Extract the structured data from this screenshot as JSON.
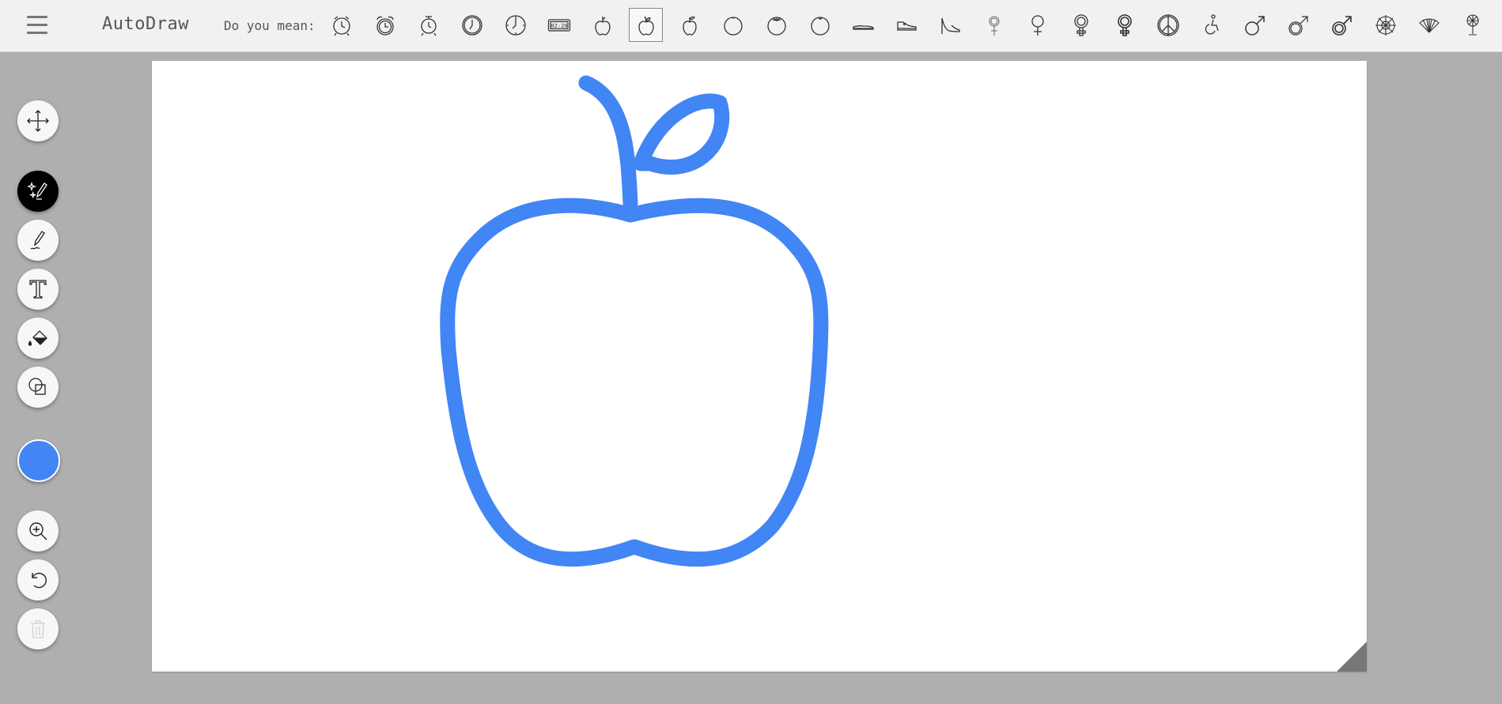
{
  "app": {
    "title": "AutoDraw"
  },
  "suggestions_bar": {
    "label": "Do you mean:",
    "items": [
      {
        "icon": "alarm-clock-icon"
      },
      {
        "icon": "alarm-clock-bells-icon"
      },
      {
        "icon": "alarm-clock-round-icon"
      },
      {
        "icon": "wall-clock-icon"
      },
      {
        "icon": "clock-face-icon"
      },
      {
        "icon": "digital-clock-icon",
        "text": "02:20"
      },
      {
        "icon": "apple-small-icon"
      },
      {
        "icon": "apple-icon",
        "selected": true
      },
      {
        "icon": "apple-leaf-icon"
      },
      {
        "icon": "orange-icon"
      },
      {
        "icon": "tomato-icon"
      },
      {
        "icon": "peach-icon"
      },
      {
        "icon": "flat-shoe-icon"
      },
      {
        "icon": "sneaker-icon"
      },
      {
        "icon": "high-heel-icon"
      },
      {
        "icon": "female-symbol-thin-icon"
      },
      {
        "icon": "female-symbol-icon"
      },
      {
        "icon": "female-symbol-bold-icon"
      },
      {
        "icon": "female-symbol-double-icon"
      },
      {
        "icon": "peace-sign-icon"
      },
      {
        "icon": "wheelchair-icon"
      },
      {
        "icon": "male-symbol-icon"
      },
      {
        "icon": "male-symbol-outline-icon"
      },
      {
        "icon": "male-symbol-double-icon"
      },
      {
        "icon": "ornament-icon"
      },
      {
        "icon": "hand-fan-icon"
      },
      {
        "icon": "electric-fan-icon"
      }
    ]
  },
  "toolbar": {
    "tools": [
      {
        "name": "move-tool",
        "icon": "move-arrows-icon"
      },
      {
        "name": "autodraw-tool",
        "icon": "magic-pencil-icon",
        "active": true
      },
      {
        "name": "draw-tool",
        "icon": "pencil-icon"
      },
      {
        "name": "type-tool",
        "icon": "text-t-icon"
      },
      {
        "name": "fill-tool",
        "icon": "paint-bucket-icon"
      },
      {
        "name": "shape-tool",
        "icon": "shapes-icon"
      },
      {
        "name": "zoom-tool",
        "icon": "zoom-in-icon"
      },
      {
        "name": "undo-tool",
        "icon": "undo-icon"
      },
      {
        "name": "delete-tool",
        "icon": "trash-icon",
        "disabled": true
      }
    ],
    "current_color": "#4285f4"
  },
  "colors": {
    "stroke": "#4285f4",
    "topbar_bg": "#f1f1f1",
    "workspace_bg": "#afafaf",
    "canvas_bg": "#ffffff",
    "active_tool_bg": "#000000"
  }
}
